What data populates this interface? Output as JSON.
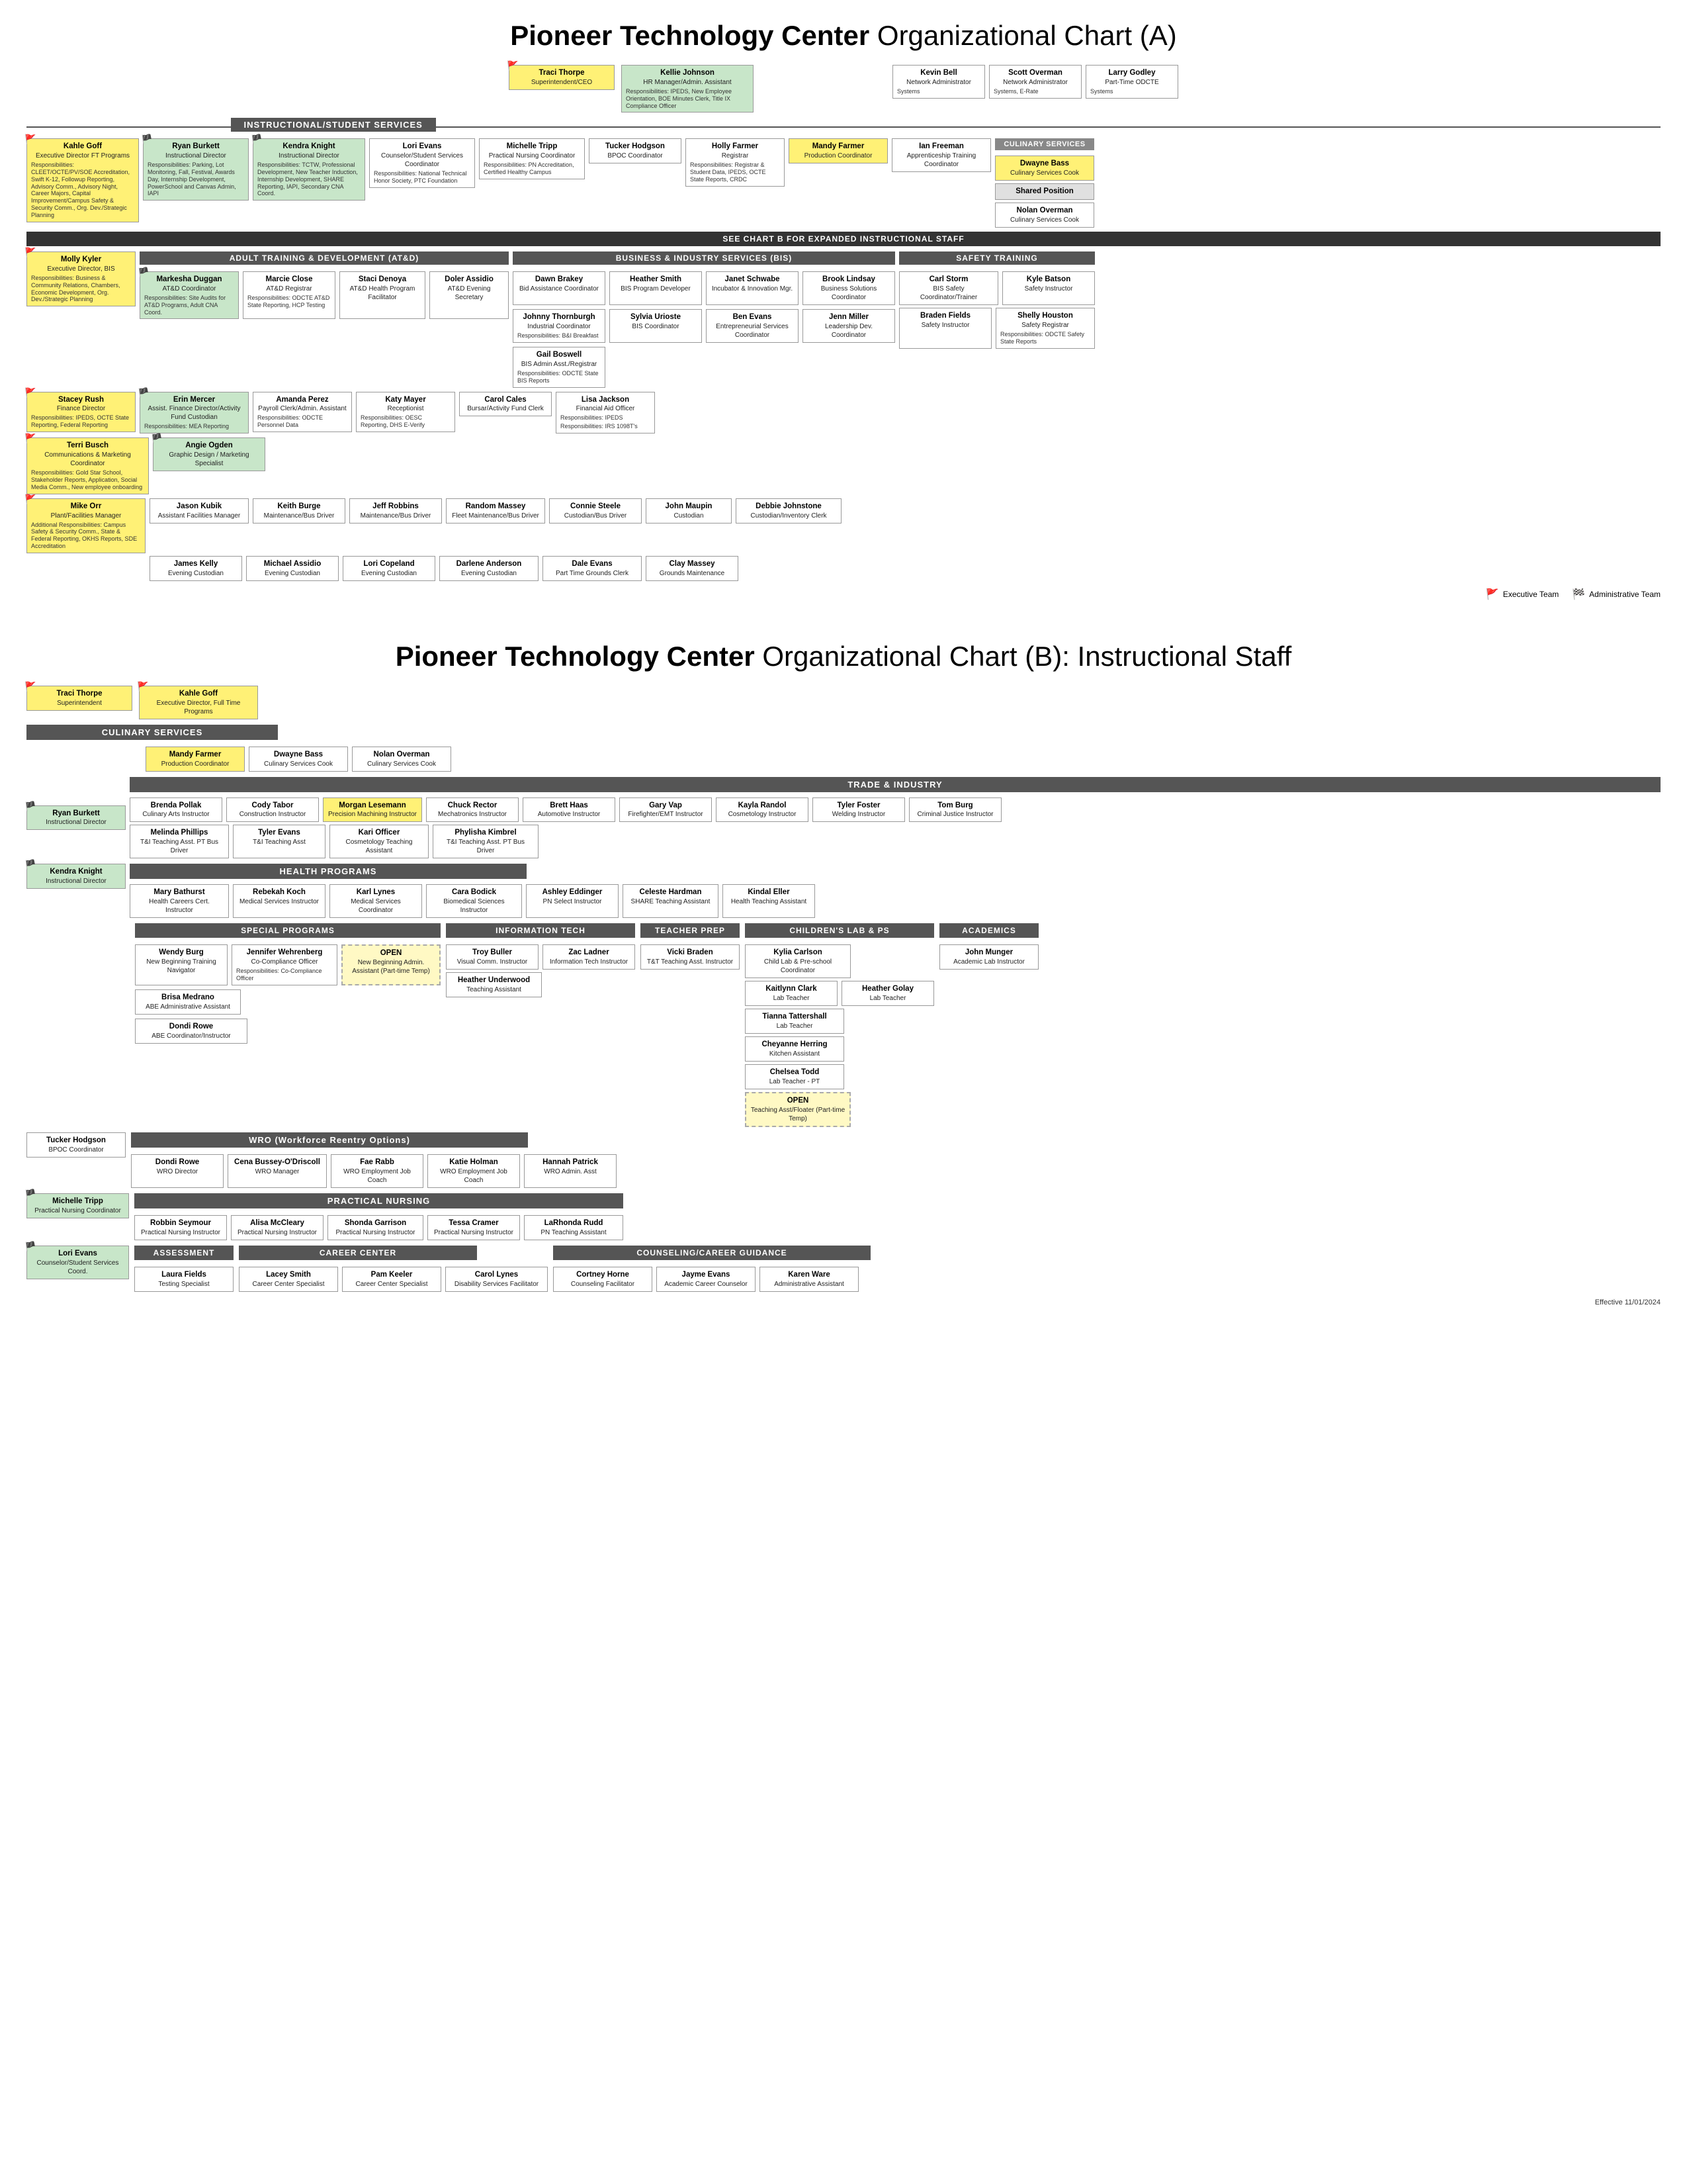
{
  "chartA": {
    "title": "Pioneer Technology Center",
    "subtitle": "Organizational Chart (A)",
    "top_row": [
      {
        "name": "Traci Thorpe",
        "title": "Superintendent/CEO",
        "flag": "red"
      },
      {
        "name": "Kellie Johnson",
        "title": "HR Manager/Admin. Assistant",
        "resp": "Responsibilities: IPEDS, New Employee Orientation, BOE Minutes Clerk, Title IX Compliance Officer"
      }
    ],
    "instructional_label": "INSTRUCTIONAL/STUDENT SERVICES",
    "instructional_staff": [
      {
        "name": "Kahle Goff",
        "title": "Executive Director FT Programs",
        "resp": "Responsibilities: CLEET/OCTE/PV/SOE Accreditation, Swift K-12, Followup Reporting, Advisory Comm., Advisory Night, Career Majors, Capital Improvement/Campus Safety & Security Comm., Org. Dev./Strategic Planning",
        "flag": "red"
      },
      {
        "name": "Ryan Burkett",
        "title": "Instructional Director",
        "flag": "green",
        "resp": "Responsibilities: Parking, Lot Monitoring, Fall, Festival, Awards Day, Internship Development, PowerSchool and Canvas Admin, IAPI"
      },
      {
        "name": "Kendra Knight",
        "title": "Instructional Director",
        "flag": "green",
        "resp": "Responsibilities: TCTW, Professional Development, New Teacher Induction, Internship Development, SHARE Reporting, IAPI, Secondary CNA Coord."
      },
      {
        "name": "Lori Evans",
        "title": "Counselor/Student Services Coordinator",
        "resp": "Responsibilities: National Technical Honor Society, PTC Foundation"
      },
      {
        "name": "Michelle Tripp",
        "title": "Practical Nursing Coordinator",
        "resp": "Responsibilities: PN Accreditation, Certified Healthy Campus"
      },
      {
        "name": "Tucker Hodgson",
        "title": "BPOC Coordinator"
      },
      {
        "name": "Holly Farmer",
        "title": "Registrar",
        "resp": "Responsibilities: Registrar & Student Data, IPEDS, OCTE State Reports, CRDC"
      },
      {
        "name": "Mandy Farmer",
        "title": "Production Coordinator"
      },
      {
        "name": "Ian Freeman",
        "title": "Apprenticeship Training Coordinator"
      }
    ],
    "culinary_services": {
      "label": "CULINARY SERVICES",
      "staff": [
        {
          "name": "Dwayne Bass",
          "title": "Culinary Services Cook"
        },
        {
          "name": "Shared Position"
        },
        {
          "name": "Nolan Overman",
          "title": "Culinary Services Cook"
        }
      ]
    },
    "see_chart_b": "SEE CHART B FOR EXPANDED INSTRUCTIONAL STAFF",
    "atd_label": "ADULT TRAINING & DEVELOPMENT (AT&D)",
    "atd_staff": [
      {
        "name": "Molly Kyler",
        "title": "Executive Director, BIS",
        "flag": "red",
        "resp": "Responsibilities: Business & Community Relations, Chambers, Economic Development, Org. Dev./Strategic Planning"
      },
      {
        "name": "Markesha Duggan",
        "title": "AT&D Coordinator",
        "flag": "green",
        "resp": "Responsibilities: Site Audits for AT&D Programs, Adult CNA Coord."
      },
      {
        "name": "Marcie Close",
        "title": "AT&D Registrar",
        "resp": "Responsibilities: ODCTE AT&D State Reporting, HCP Testing"
      },
      {
        "name": "Staci Denoya",
        "title": "AT&D Health Program Facilitator"
      },
      {
        "name": "Doler Assidio",
        "title": "AT&D Evening Secretary"
      }
    ],
    "bis_label": "BUSINESS & INDUSTRY SERVICES (BIS)",
    "bis_staff": [
      {
        "name": "Dawn Brakey",
        "title": "Bid Assistance Coordinator"
      },
      {
        "name": "Heather Smith",
        "title": "BIS Program Developer"
      },
      {
        "name": "Janet Schwabe",
        "title": "Incubator & Innovation Mgr."
      },
      {
        "name": "Brook Lindsay",
        "title": "Business Solutions Coordinator"
      },
      {
        "name": "Johnny Thornburgh",
        "title": "Industrial Coordinator",
        "resp": "Responsibilities: B&I Breakfast"
      },
      {
        "name": "Sylvia Urioste",
        "title": "BIS Coordinator"
      },
      {
        "name": "Ben Evans",
        "title": "Entrepreneurial Services Coordinator"
      },
      {
        "name": "Jenn Miller",
        "title": "Leadership Dev. Coordinator"
      },
      {
        "name": "Gail Boswell",
        "title": "BIS Admin Asst./Registrar",
        "resp": "Responsibilities: ODCTE State BIS Reports"
      }
    ],
    "safety_label": "SAFETY TRAINING",
    "safety_staff": [
      {
        "name": "Carl Storm",
        "title": "BIS Safety Coordinator/Trainer"
      },
      {
        "name": "Kyle Batson",
        "title": "Safety Instructor"
      },
      {
        "name": "Braden Fields",
        "title": "Safety Instructor"
      },
      {
        "name": "Shelly Houston",
        "title": "Safety Registrar",
        "resp": "Responsibilities: ODCTE Safety State Reports"
      }
    ],
    "finance_row": [
      {
        "name": "Stacey Rush",
        "title": "Finance Director",
        "flag": "red",
        "resp": "Responsibilities: IPEDS, OCTE State Reporting, Federal Reporting"
      },
      {
        "name": "Erin Mercer",
        "title": "Assist. Finance Director/Activity Fund Custodian",
        "flag": "green",
        "resp": "Responsibilities: MEA Reporting"
      },
      {
        "name": "Amanda Perez",
        "title": "Payroll Clerk/Admin. Assistant",
        "resp": "Responsibilities: ODCTE Personnel Data"
      },
      {
        "name": "Katy Mayer",
        "title": "Receptionist",
        "resp": "Responsibilities: OESC Reporting, DHS E-Verify"
      },
      {
        "name": "Carol Cales",
        "title": "Bursar/Activity Fund Clerk"
      },
      {
        "name": "Lisa Jackson",
        "title": "Financial Aid Officer",
        "resp": "Responsibilities: IPEDS",
        "extra": "Responsibilities: IRS 1098T's"
      }
    ],
    "comm_row": [
      {
        "name": "Terri Busch",
        "title": "Communications & Marketing Coordinator",
        "flag": "red",
        "resp": "Responsibilities: Gold Star School, Stakeholder Reports, Application, Social Media Comm., New employee onboarding"
      },
      {
        "name": "Angie Ogden",
        "title": "Graphic Design / Marketing Specialist",
        "flag": "green"
      }
    ],
    "facilities_row": [
      {
        "name": "Mike Orr",
        "title": "Plant/Facilities Manager",
        "flag": "red",
        "resp": "Additional Responsibilities: Campus Safety & Security Comm., State & Federal Reporting, OKHS Reports, SDE Accreditation"
      },
      {
        "name": "Jason Kubik",
        "title": "Assistant Facilities Manager"
      },
      {
        "name": "Keith Burge",
        "title": "Maintenance/Bus Driver"
      },
      {
        "name": "Jeff Robbins",
        "title": "Maintenance/Bus Driver"
      },
      {
        "name": "Random Massey",
        "title": "Fleet Maintenance/Bus Driver"
      },
      {
        "name": "Connie Steele",
        "title": "Custodian/Bus Driver"
      },
      {
        "name": "John Maupin",
        "title": "Custodian"
      },
      {
        "name": "Debbie Johnstone",
        "title": "Custodian/Inventory Clerk"
      }
    ],
    "evening_row": [
      {
        "name": "James Kelly",
        "title": "Evening Custodian"
      },
      {
        "name": "Michael Assidio",
        "title": "Evening Custodian"
      },
      {
        "name": "Lori Copeland",
        "title": "Evening Custodian"
      },
      {
        "name": "Darlene Anderson",
        "title": "Evening Custodian"
      },
      {
        "name": "Dale Evans",
        "title": "Part Time Grounds Clerk"
      },
      {
        "name": "Clay Massey",
        "title": "Grounds Maintenance"
      }
    ],
    "kevin_bell": {
      "name": "Kevin Bell",
      "title": "Network Administrator",
      "resp": "Systems"
    },
    "scott_overman": {
      "name": "Scott Overman",
      "title": "Network Administrator",
      "resp": "Systems, E-Rate"
    },
    "larry_godley": {
      "name": "Larry Godley",
      "title": "Part-Time ODCTE",
      "resp": "Systems"
    },
    "legend": {
      "exec": "Executive Team",
      "admin": "Administrative Team"
    }
  },
  "chartB": {
    "title": "Pioneer Technology Center",
    "subtitle": "Organizational Chart (B): Instructional Staff",
    "top": [
      {
        "name": "Traci Thorpe",
        "title": "Superintendent",
        "flag": "red"
      },
      {
        "name": "Kahle Goff",
        "title": "Executive Director, Full Time Programs",
        "flag": "red"
      }
    ],
    "culinary_label": "CULINARY SERVICES",
    "culinary_staff": [
      {
        "name": "Mandy Farmer",
        "title": "Production Coordinator"
      },
      {
        "name": "Dwayne Bass",
        "title": "Culinary Services Cook"
      },
      {
        "name": "Nolan Overman",
        "title": "Culinary Services Cook"
      }
    ],
    "trade_label": "TRADE & INDUSTRY",
    "trade_instructional_dir": {
      "name": "Ryan Burkett",
      "title": "Instructional Director",
      "flag": "green"
    },
    "trade_staff": [
      {
        "name": "Brenda Pollak",
        "title": "Culinary Arts Instructor"
      },
      {
        "name": "Cody Tabor",
        "title": "Construction Instructor"
      },
      {
        "name": "Morgan Lesemann",
        "title": "Precision Machining Instructor"
      },
      {
        "name": "Chuck Rector",
        "title": "Mechatronics Instructor"
      },
      {
        "name": "Brett Haas",
        "title": "Automotive Instructor"
      },
      {
        "name": "Gary Vap",
        "title": "Firefighter/EMT Instructor"
      },
      {
        "name": "Kayla Randol",
        "title": "Cosmetology Instructor"
      },
      {
        "name": "Tyler Foster",
        "title": "Welding Instructor"
      },
      {
        "name": "Tom Burg",
        "title": "Criminal Justice Instructor"
      }
    ],
    "trade_assistants": [
      {
        "name": "Melinda Phillips",
        "title": "T&I Teaching Asst. PT Bus Driver"
      },
      {
        "name": "Tyler Evans",
        "title": "T&I Teaching Asst"
      },
      {
        "name": "Kari Officer",
        "title": "Cosmetology Teaching Assistant"
      },
      {
        "name": "Phylisha Kimbrel",
        "title": "T&I Teaching Asst. PT Bus Driver"
      }
    ],
    "health_label": "HEALTH PROGRAMS",
    "health_dir": {
      "name": "Kendra Knight",
      "title": "Instructional Director",
      "flag": "green"
    },
    "health_staff": [
      {
        "name": "Mary Bathurst",
        "title": "Health Careers Cert. Instructor"
      },
      {
        "name": "Rebekah Koch",
        "title": "Medical Services Instructor"
      },
      {
        "name": "Karl Lynes",
        "title": "Medical Services Coordinator"
      },
      {
        "name": "Cara Bodick",
        "title": "Biomedical Sciences Instructor"
      },
      {
        "name": "Ashley Eddinger",
        "title": "PN Select Instructor"
      },
      {
        "name": "Celeste Hardman",
        "title": "SHARE Teaching Assistant"
      },
      {
        "name": "Kindal Eller",
        "title": "Health Teaching Assistant"
      }
    ],
    "special_label": "SPECIAL PROGRAMS",
    "special_staff": [
      {
        "name": "Wendy Burg",
        "title": "New Beginning Training Navigator"
      },
      {
        "name": "Jennifer Wehrenberg",
        "title": "Co-Compliance Officer",
        "resp": "Responsibilities: Co-Compliance Officer"
      },
      {
        "name": "OPEN",
        "title": "New Beginning Admin. Assistant (Part-time Temp)"
      }
    ],
    "info_label": "INFORMATION TECH",
    "info_staff": [
      {
        "name": "Troy Buller",
        "title": "Visual Comm. Instructor"
      },
      {
        "name": "Zac Ladner",
        "title": "Information Tech Instructor"
      },
      {
        "name": "Heather Underwood",
        "title": "Teaching Assistant"
      }
    ],
    "teacher_prep_label": "TEACHER PREP",
    "teacher_prep": {
      "name": "Vicki Braden",
      "title": "T&T Teaching Asst. Instructor"
    },
    "childrens_label": "CHILDREN'S LAB & PS",
    "childrens_staff": [
      {
        "name": "Kylia Carlson",
        "title": "Child Lab & Pre-school Coordinator"
      },
      {
        "name": "Kaitlynn Clark",
        "title": "Lab Teacher"
      },
      {
        "name": "Heather Golay",
        "title": "Lab Teacher"
      },
      {
        "name": "Tianna Tattershall",
        "title": "Lab Teacher"
      },
      {
        "name": "Cheyanne Herring",
        "title": "Kitchen Assistant"
      },
      {
        "name": "Chelsea Todd",
        "title": "Lab Teacher - PT"
      },
      {
        "name": "OPEN",
        "title": "Teaching Asst/Floater (Part-time Temp)"
      }
    ],
    "academics_label": "ACADEMICS",
    "academics_staff": [
      {
        "name": "John Munger",
        "title": "Academic Lab Instructor"
      }
    ],
    "tucker": {
      "name": "Tucker Hodgson",
      "title": "BPOC Coordinator"
    },
    "wro_label": "WRO",
    "wro_staff": [
      {
        "name": "Dondi Rowe",
        "title": "WRO Director"
      },
      {
        "name": "Cena Bussey-O'Driscoll",
        "title": "WRO Manager"
      },
      {
        "name": "Fae Rabb",
        "title": "WRO Employment Job Coach"
      },
      {
        "name": "Katie Holman",
        "title": "WRO Employment Job Coach"
      },
      {
        "name": "Hannah Patrick",
        "title": "WRO Admin. Asst"
      }
    ],
    "brisa": {
      "name": "Brisa Medrano",
      "title": "ABE Administrative Assistant"
    },
    "dondi_coord": {
      "name": "Dondi Rowe",
      "title": "ABE Coordinator/Instructor"
    },
    "practical_nursing_label": "PRACTICAL NURSING",
    "pn_coord": {
      "name": "Michelle Tripp",
      "title": "Practical Nursing Coordinator",
      "flag": "green"
    },
    "pn_staff": [
      {
        "name": "Robbin Seymour",
        "title": "Practical Nursing Instructor"
      },
      {
        "name": "Alisa McCleary",
        "title": "Practical Nursing Instructor"
      },
      {
        "name": "Shonda Garrison",
        "title": "Practical Nursing Instructor"
      },
      {
        "name": "Tessa Cramer",
        "title": "Practical Nursing Instructor"
      },
      {
        "name": "LaRhonda Rudd",
        "title": "PN Teaching Assistant"
      }
    ],
    "lori_evans": {
      "name": "Lori Evans",
      "title": "Counselor/Student Services Coord.",
      "flag": "green"
    },
    "assessment_label": "ASSESSMENT",
    "assessment_staff": [
      {
        "name": "Laura Fields",
        "title": "Testing Specialist"
      }
    ],
    "career_label": "CAREER CENTER",
    "career_staff": [
      {
        "name": "Lacey Smith",
        "title": "Career Center Specialist"
      },
      {
        "name": "Pam Keeler",
        "title": "Career Center Specialist"
      },
      {
        "name": "Carol Lynes",
        "title": "Disability Services Facilitator"
      }
    ],
    "counseling_label": "COUNSELING/CAREER GUIDANCE",
    "counseling_staff": [
      {
        "name": "Cortney Horne",
        "title": "Counseling Facilitator"
      },
      {
        "name": "Jayme Evans",
        "title": "Academic Career Counselor"
      },
      {
        "name": "Karen Ware",
        "title": "Administrative Assistant"
      }
    ],
    "effective": "Effective 11/01/2024"
  }
}
